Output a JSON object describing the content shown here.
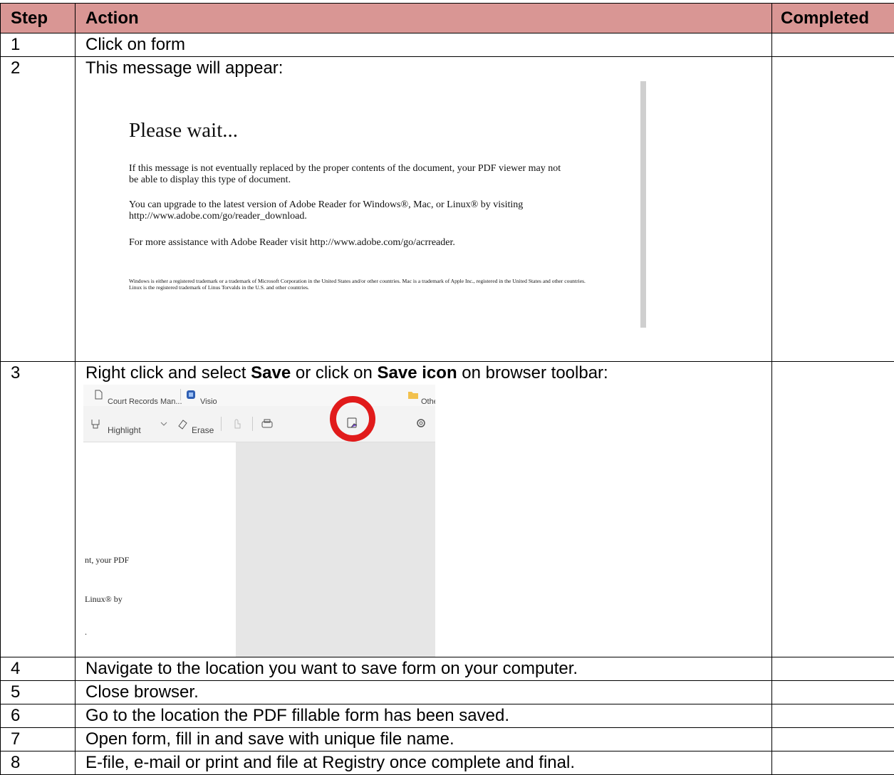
{
  "table": {
    "headers": {
      "step": "Step",
      "action": "Action",
      "completed": "Completed"
    },
    "header_color": "#d99694",
    "rows": [
      {
        "step": "1",
        "action": "Click on form"
      },
      {
        "step": "2",
        "action": "This message will appear:"
      },
      {
        "step": "3",
        "action_pre": "Right click and select ",
        "action_bold1": "Save",
        "action_mid": " or click on ",
        "action_bold2": "Save icon",
        "action_post": " on browser toolbar:"
      },
      {
        "step": "4",
        "action": "Navigate to the location you want to save form on your computer."
      },
      {
        "step": "5",
        "action": "Close browser."
      },
      {
        "step": "6",
        "action": "Go to the location the PDF fillable form has been saved."
      },
      {
        "step": "7",
        "action": "Open form, fill in and save with unique file name."
      },
      {
        "step": "8",
        "action": "E-file, e-mail or print and file at Registry once complete and final."
      }
    ]
  },
  "pdf_message": {
    "title": "Please wait...",
    "p1": "If this message is not eventually replaced by the proper contents of the document, your PDF viewer may not be able to display this type of document.",
    "p2": "You can upgrade to the latest version of Adobe Reader for Windows®, Mac, or Linux® by visiting  http://www.adobe.com/go/reader_download.",
    "p3": "For more assistance with Adobe Reader visit  http://www.adobe.com/go/acrreader.",
    "fine": "Windows is either a registered trademark or a trademark of Microsoft Corporation in the United States and/or other countries. Mac is a trademark of Apple Inc., registered in the United States and other countries. Linux is the registered trademark of Linus Torvalds in the U.S. and other countries."
  },
  "browser_toolbar": {
    "bookmark1": "Court Records Man...",
    "bookmark2": "Visio",
    "bookmark3": "Othe",
    "highlight": "Highlight",
    "erase": "Erase",
    "page_text1": "nt, your PDF",
    "page_text2": "Linux® by",
    "page_text3": ".",
    "highlight_ring_color": "#e11b1b"
  }
}
